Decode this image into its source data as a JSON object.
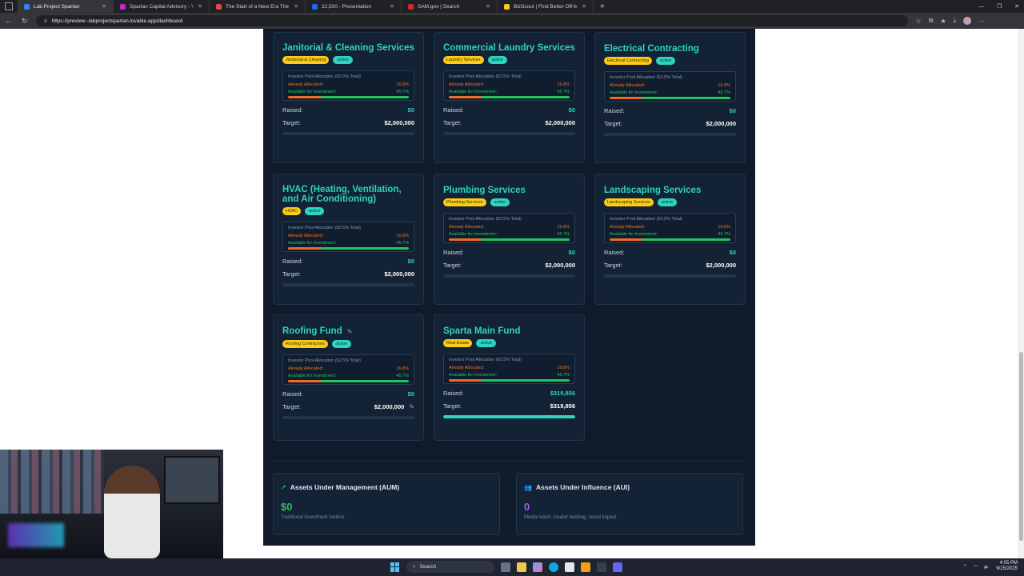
{
  "browser": {
    "tabs": [
      {
        "title": "Lab Project Spartan",
        "active": true,
        "fav_color": "#3b82f6"
      },
      {
        "title": "Spartan Capital Advisory - Your O",
        "active": false,
        "fav_color": "#c026d3"
      },
      {
        "title": "The Start of a New Era The GovFi",
        "active": false,
        "fav_color": "#ef4444"
      },
      {
        "title": "22,500 - Presentation",
        "active": false,
        "fav_color": "#2563eb"
      },
      {
        "title": "SAM.gov | Search",
        "active": false,
        "fav_color": "#dc2626"
      },
      {
        "title": "BizScout | Find Better Off-Market",
        "active": false,
        "fav_color": "#facc15"
      }
    ],
    "url": "https://preview--labprojectspartan.lovable.app/dashboard"
  },
  "pool_labels": {
    "title": "Investor Pool Allocation (62.5% Total)",
    "allocated": "Already Allocated:",
    "available": "Available for Investment:",
    "allocated_value": "16.8%",
    "available_value": "45.7%",
    "allocated_pct": 16.8,
    "available_pct": 45.7
  },
  "labels": {
    "raised": "Raised:",
    "target": "Target:"
  },
  "funds": [
    {
      "title": "Janitorial & Cleaning Services",
      "category": "Janitorial & Cleaning",
      "status": "active",
      "raised": "$0",
      "target": "$2,000,000",
      "progress": 0
    },
    {
      "title": "Commercial Laundry Services",
      "category": "Laundry Services",
      "status": "active",
      "raised": "$0",
      "target": "$2,000,000",
      "progress": 0
    },
    {
      "title": "Electrical Contracting",
      "category": "Electrical Contracting",
      "status": "active",
      "raised": "$0",
      "target": "$2,000,000",
      "progress": 0
    },
    {
      "title": "HVAC (Heating, Ventilation, and Air Conditioning)",
      "category": "HVAC",
      "status": "active",
      "raised": "$0",
      "target": "$2,000,000",
      "progress": 0
    },
    {
      "title": "Plumbing Services",
      "category": "Plumbing Services",
      "status": "active",
      "raised": "$0",
      "target": "$2,000,000",
      "progress": 0
    },
    {
      "title": "Landscaping Services",
      "category": "Landscaping Services",
      "status": "active",
      "raised": "$0",
      "target": "$2,000,000",
      "progress": 0
    },
    {
      "title": "Roofing Fund",
      "category": "Roofing Contractors",
      "status": "active",
      "raised": "$0",
      "target": "$2,000,000",
      "progress": 0
    },
    {
      "title": "Sparta Main Fund",
      "category": "Real Estate",
      "status": "active",
      "raised": "$319,856",
      "target": "$319,856",
      "progress": 1
    }
  ],
  "aum": {
    "title": "Assets Under Management (AUM)",
    "value": "$0",
    "subtitle": "Traditional investment metrics",
    "color": "#22c55e"
  },
  "aui": {
    "title": "Assets Under Influence (AUI)",
    "value": "0",
    "subtitle": "Media reach, creator backing, social impact",
    "color": "#a855f7"
  },
  "taskbar": {
    "search": "Search",
    "time": "4:05 PM",
    "date": "9/15/2025"
  }
}
